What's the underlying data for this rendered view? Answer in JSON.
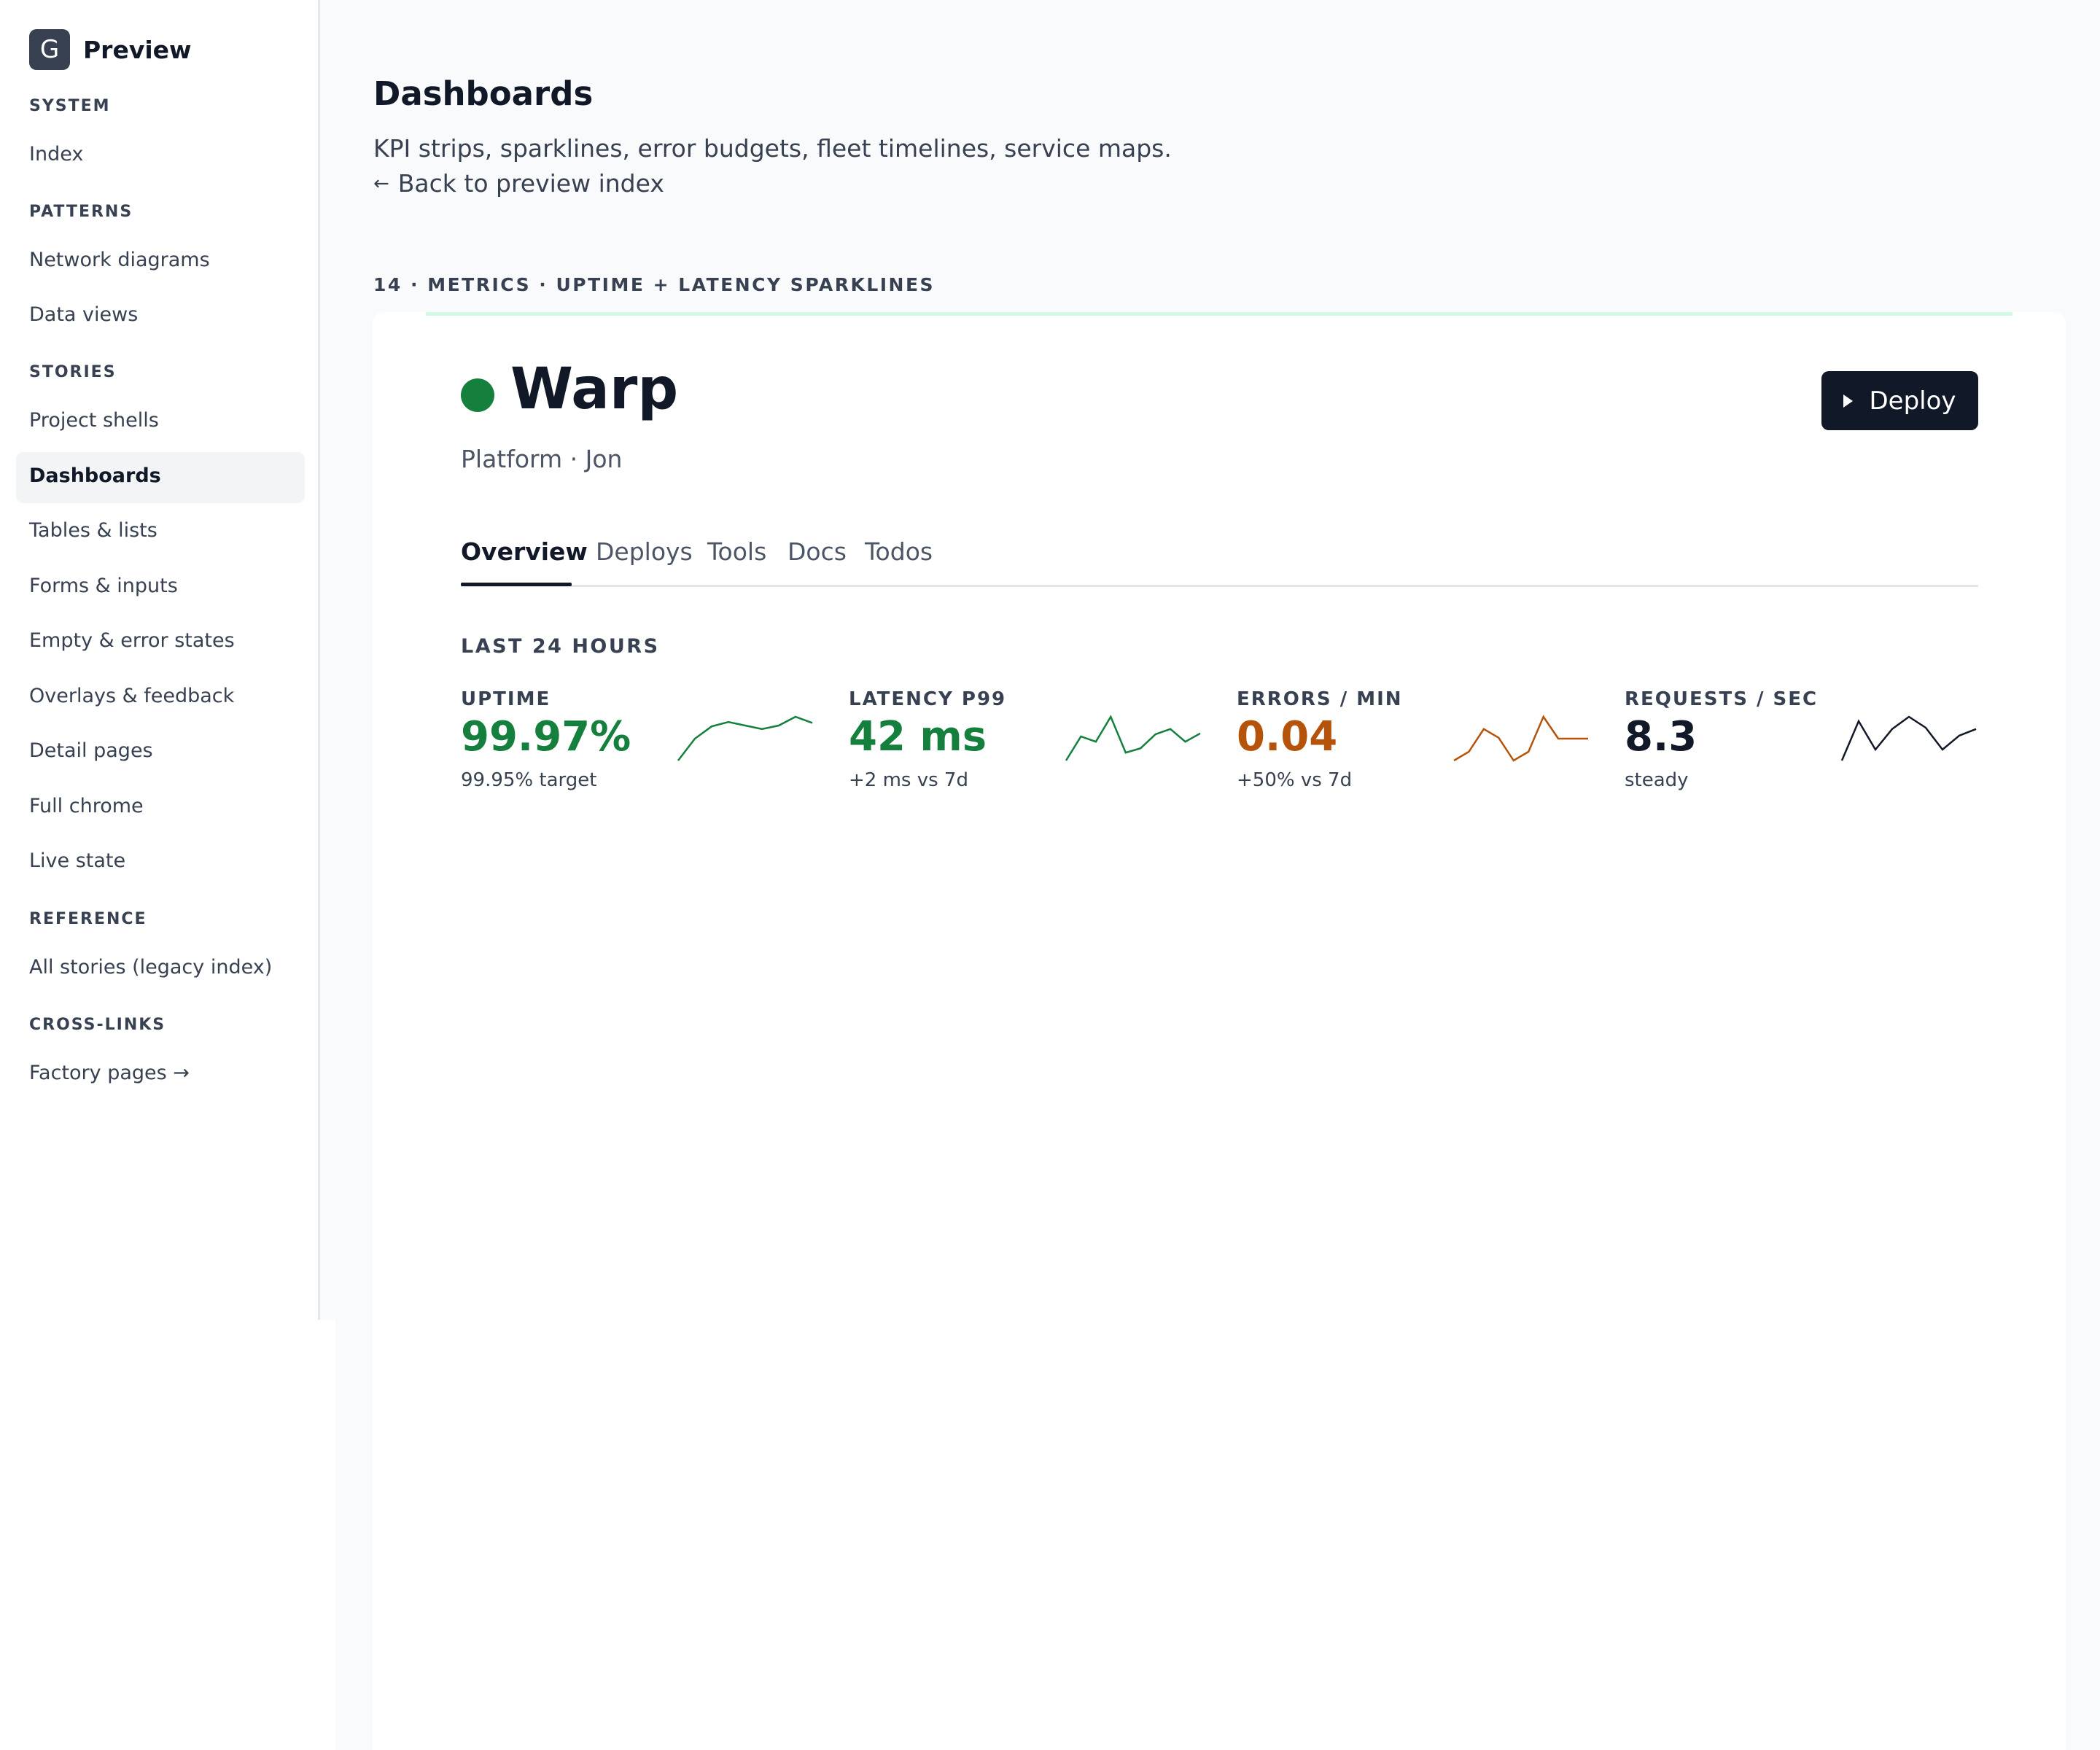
{
  "brand": {
    "badge": "G",
    "title": "Preview"
  },
  "sidebar": {
    "sections": [
      {
        "heading": "SYSTEM",
        "items": [
          "Index"
        ]
      },
      {
        "heading": "PATTERNS",
        "items": [
          "Network diagrams",
          "Data views"
        ]
      },
      {
        "heading": "STORIES",
        "items": [
          "Project shells",
          "Dashboards",
          "Tables & lists",
          "Forms & inputs",
          "Empty & error states",
          "Overlays & feedback",
          "Detail pages",
          "Full chrome",
          "Live state"
        ]
      },
      {
        "heading": "REFERENCE",
        "items": [
          "All stories (legacy index)"
        ]
      },
      {
        "heading": "CROSS-LINKS",
        "items": [
          "Factory pages →"
        ]
      }
    ],
    "active_item": "Dashboards"
  },
  "header": {
    "title": "Dashboards",
    "subtitle": "KPI strips, sparklines, error budgets, fleet timelines, service maps.",
    "back_arrow": "←",
    "back_label": "Back to preview index"
  },
  "section_label": "14 · METRICS · UPTIME + LATENCY SPARKLINES",
  "service": {
    "name": "Warp",
    "meta": "Platform · Jon",
    "status_color": "#15803d",
    "deploy_label": "Deploy"
  },
  "tabs": [
    "Overview",
    "Deploys",
    "Tools",
    "Docs",
    "Todos"
  ],
  "active_tab": "Overview",
  "period_label": "LAST 24 HOURS",
  "kpis": [
    {
      "label": "UPTIME",
      "value": "99.97%",
      "sub": "99.95% target",
      "color": "#15803d",
      "spark": [
        0.0,
        0.5,
        0.78,
        0.88,
        0.8,
        0.72,
        0.8,
        1.0,
        0.86
      ]
    },
    {
      "label": "LATENCY P99",
      "value": "42 ms",
      "sub": "+2 ms vs 7d",
      "color": "#15803d",
      "spark": [
        0.0,
        0.55,
        0.43,
        1.0,
        0.18,
        0.28,
        0.6,
        0.72,
        0.43,
        0.62
      ]
    },
    {
      "label": "ERRORS / MIN",
      "value": "0.04",
      "sub": "+50% vs 7d",
      "color": "#b45309",
      "spark": [
        0.0,
        0.2,
        0.72,
        0.52,
        0.0,
        0.2,
        1.0,
        0.5,
        0.5,
        0.5
      ]
    },
    {
      "label": "REQUESTS / SEC",
      "value": "8.3",
      "sub": "steady",
      "color": "#111827",
      "spark": [
        0.0,
        0.9,
        0.25,
        0.72,
        1.0,
        0.75,
        0.25,
        0.57,
        0.72
      ]
    }
  ]
}
